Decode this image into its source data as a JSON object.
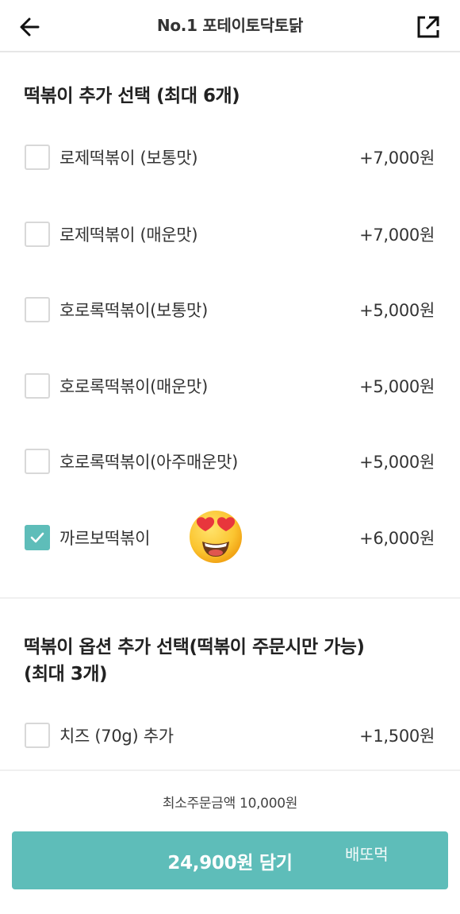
{
  "header": {
    "title": "No.1 포테이토닥토닭"
  },
  "section1": {
    "title": "떡볶이 추가 선택 (최대 6개)",
    "options": [
      {
        "label": "로제떡볶이 (보통맛)",
        "price": "+7,000원",
        "checked": false
      },
      {
        "label": "로제떡볶이 (매운맛)",
        "price": "+7,000원",
        "checked": false
      },
      {
        "label": "호로록떡볶이(보통맛)",
        "price": "+5,000원",
        "checked": false
      },
      {
        "label": "호로록떡볶이(매운맛)",
        "price": "+5,000원",
        "checked": false
      },
      {
        "label": "호로록떡볶이(아주매운맛)",
        "price": "+5,000원",
        "checked": false
      },
      {
        "label": "까르보떡볶이",
        "price": "+6,000원",
        "checked": true
      }
    ]
  },
  "section2": {
    "title_line1": "떡볶이 옵션 추가 선택(떡볶이 주문시만 가능)",
    "title_line2": "(최대 3개)",
    "options": [
      {
        "label": "치즈 (70g) 추가",
        "price": "+1,500원",
        "checked": false
      }
    ]
  },
  "footer": {
    "min_order": "최소주문금액 10,000원",
    "cart_button_label": "24,900원 담기",
    "watermark": "배또먹"
  },
  "colors": {
    "accent": "#5ebdb9",
    "checkbox_border": "#d8d8d8"
  },
  "icons": {
    "back": "arrow-left-icon",
    "share": "share-icon",
    "check": "check-icon",
    "emoji": "heart-eyes-emoji"
  }
}
